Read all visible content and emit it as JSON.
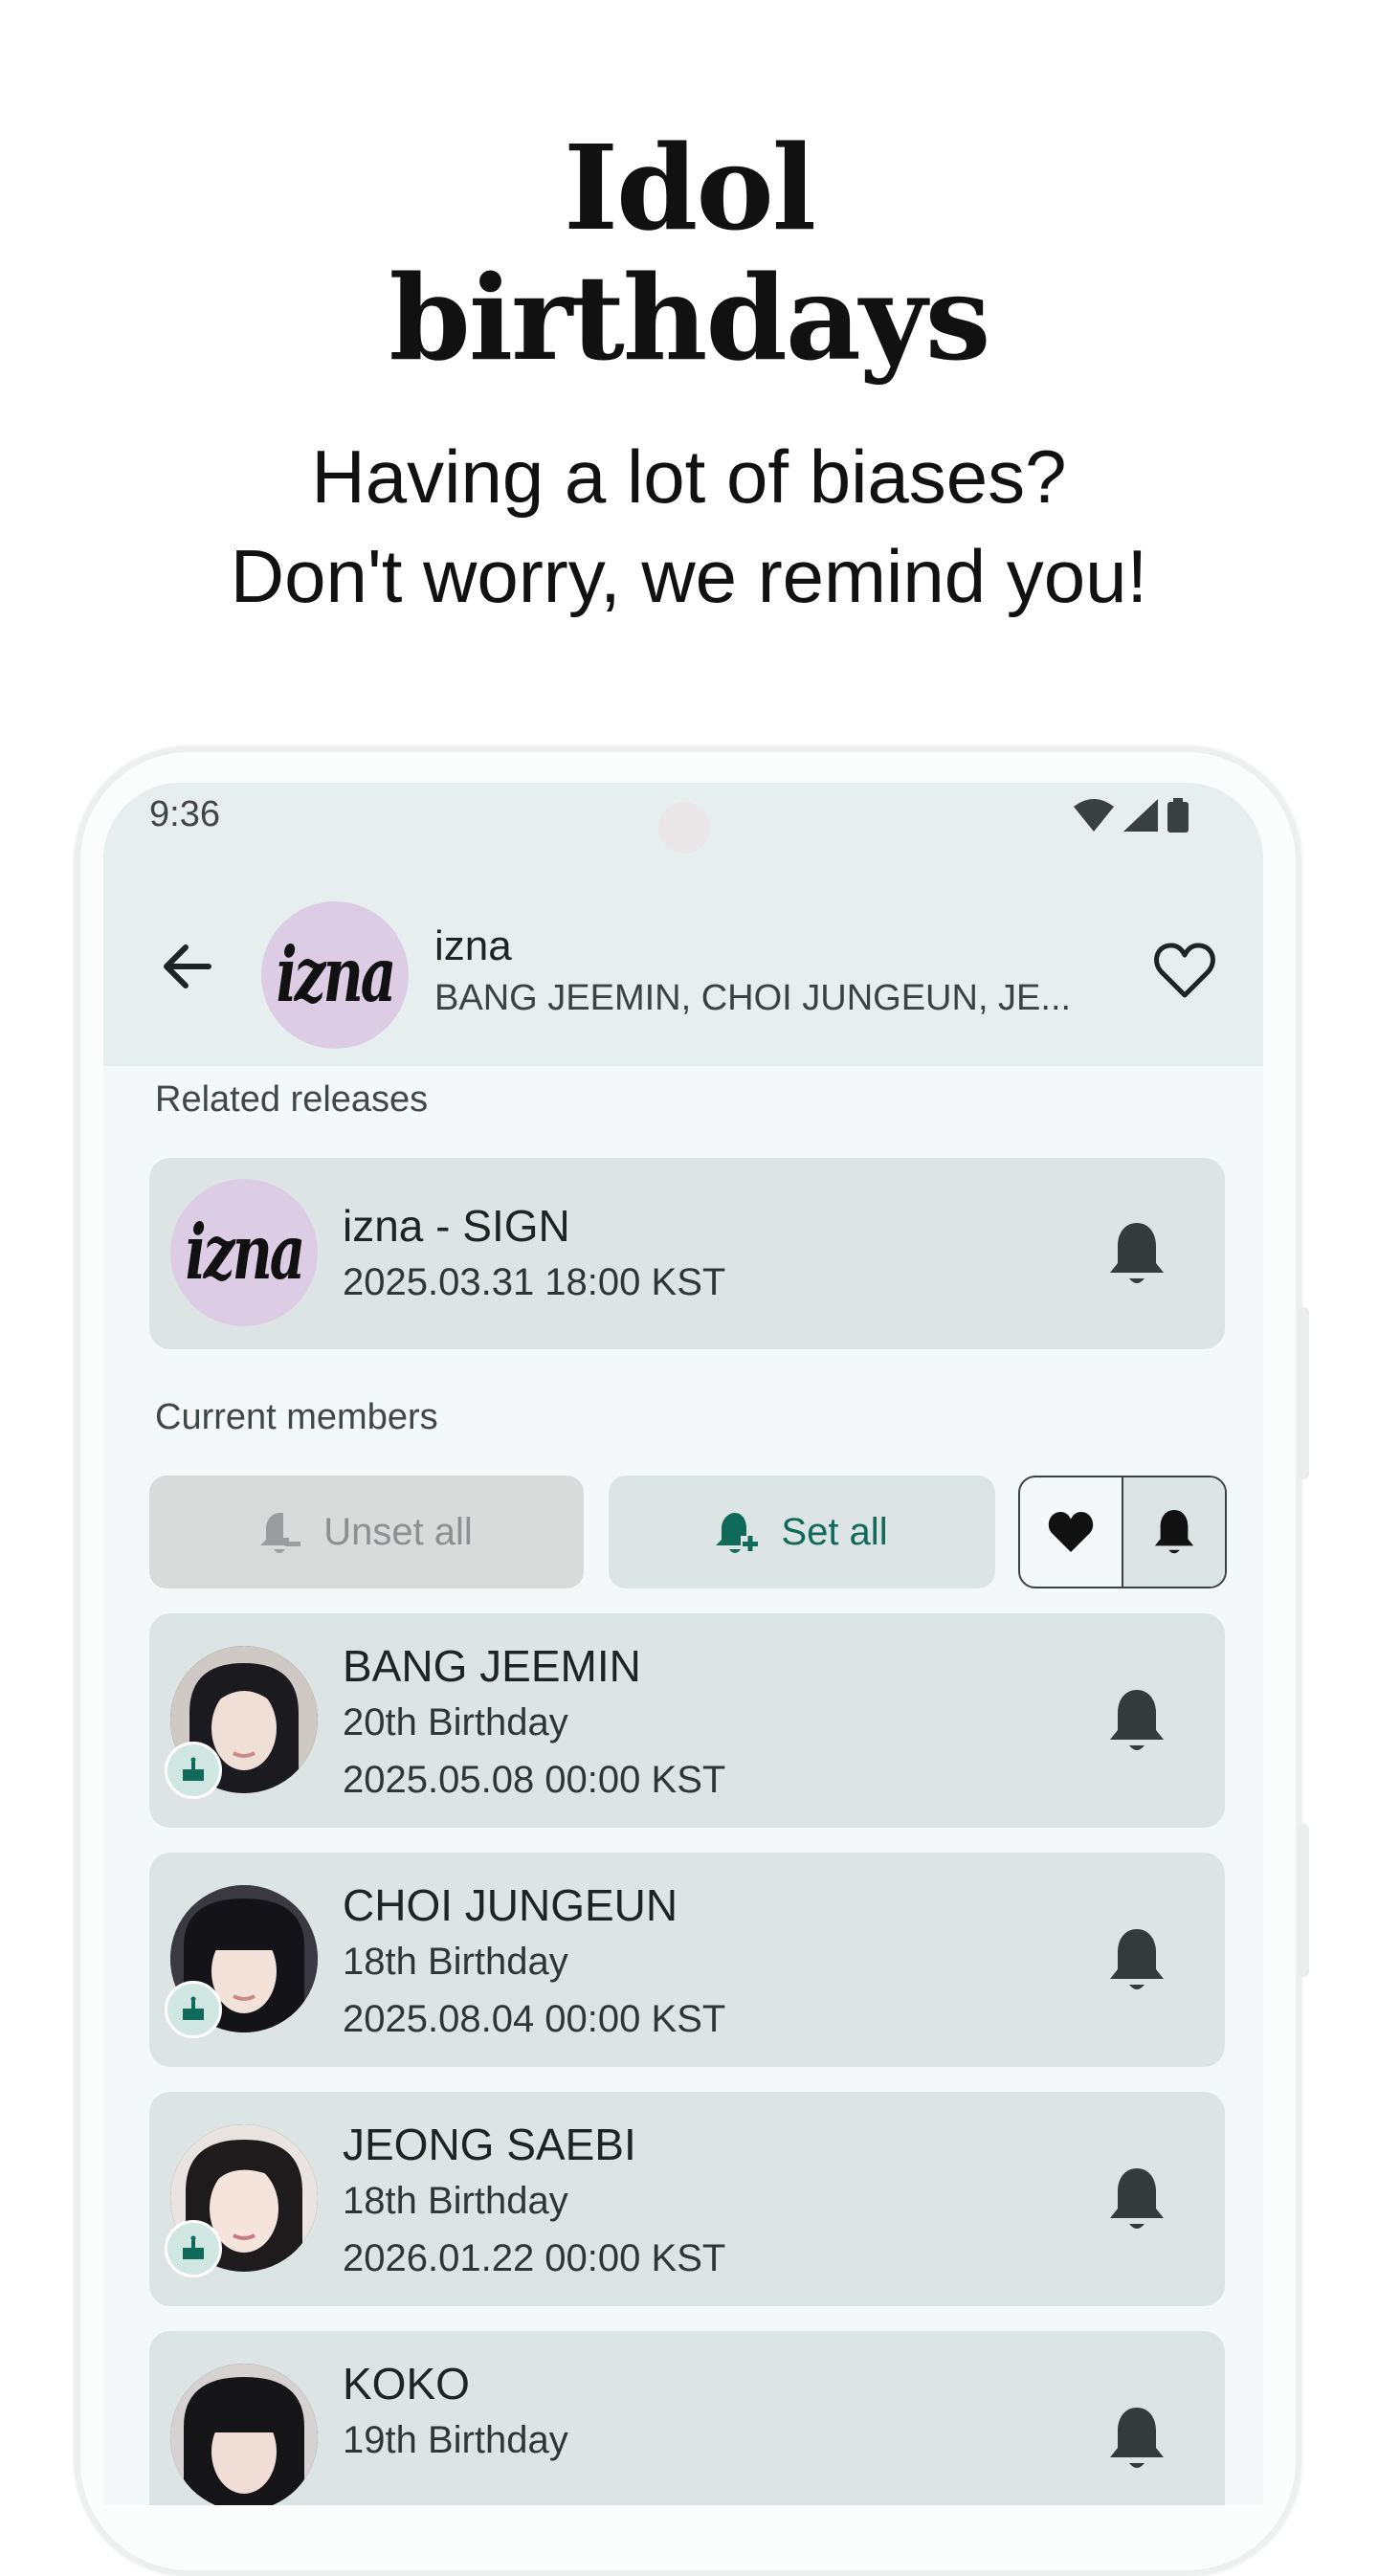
{
  "promo": {
    "title_line1": "Idol",
    "title_line2": "birthdays",
    "subtitle_line1": "Having a lot of biases?",
    "subtitle_line2": "Don't worry, we remind you!"
  },
  "status_bar": {
    "time": "9:36",
    "icons": [
      "wifi-icon",
      "signal-icon",
      "battery-icon"
    ]
  },
  "header": {
    "logo_text": "izna",
    "name": "izna",
    "members": "BANG JEEMIN, CHOI JUNGEUN, JE...",
    "icons": {
      "back": "arrow-left-icon",
      "favorite": "heart-outline-icon"
    }
  },
  "related_releases": {
    "section_label": "Related releases",
    "items": [
      {
        "logo_text": "izna",
        "title": "izna - SIGN",
        "datetime": "2025.03.31 18:00 KST",
        "icon": "bell-icon"
      }
    ]
  },
  "current_members": {
    "section_label": "Current members",
    "unset_all_label": "Unset all",
    "set_all_label": "Set all",
    "filter_icons": [
      "heart-filled-icon",
      "bell-icon"
    ],
    "members": [
      {
        "name": "BANG JEEMIN",
        "birthday": "20th Birthday",
        "datetime": "2025.05.08 00:00 KST"
      },
      {
        "name": "CHOI JUNGEUN",
        "birthday": "18th Birthday",
        "datetime": "2025.08.04 00:00 KST"
      },
      {
        "name": "JEONG SAEBI",
        "birthday": "18th Birthday",
        "datetime": "2026.01.22 00:00 KST"
      },
      {
        "name": "KOKO",
        "birthday": "19th Birthday",
        "datetime": ""
      }
    ]
  },
  "colors": {
    "accent": "#0f6a5a",
    "card": "#dde5e4",
    "topbar": "#e6eeee",
    "logo_bg": "#dccde4",
    "disabled_button": "#d9dada"
  }
}
